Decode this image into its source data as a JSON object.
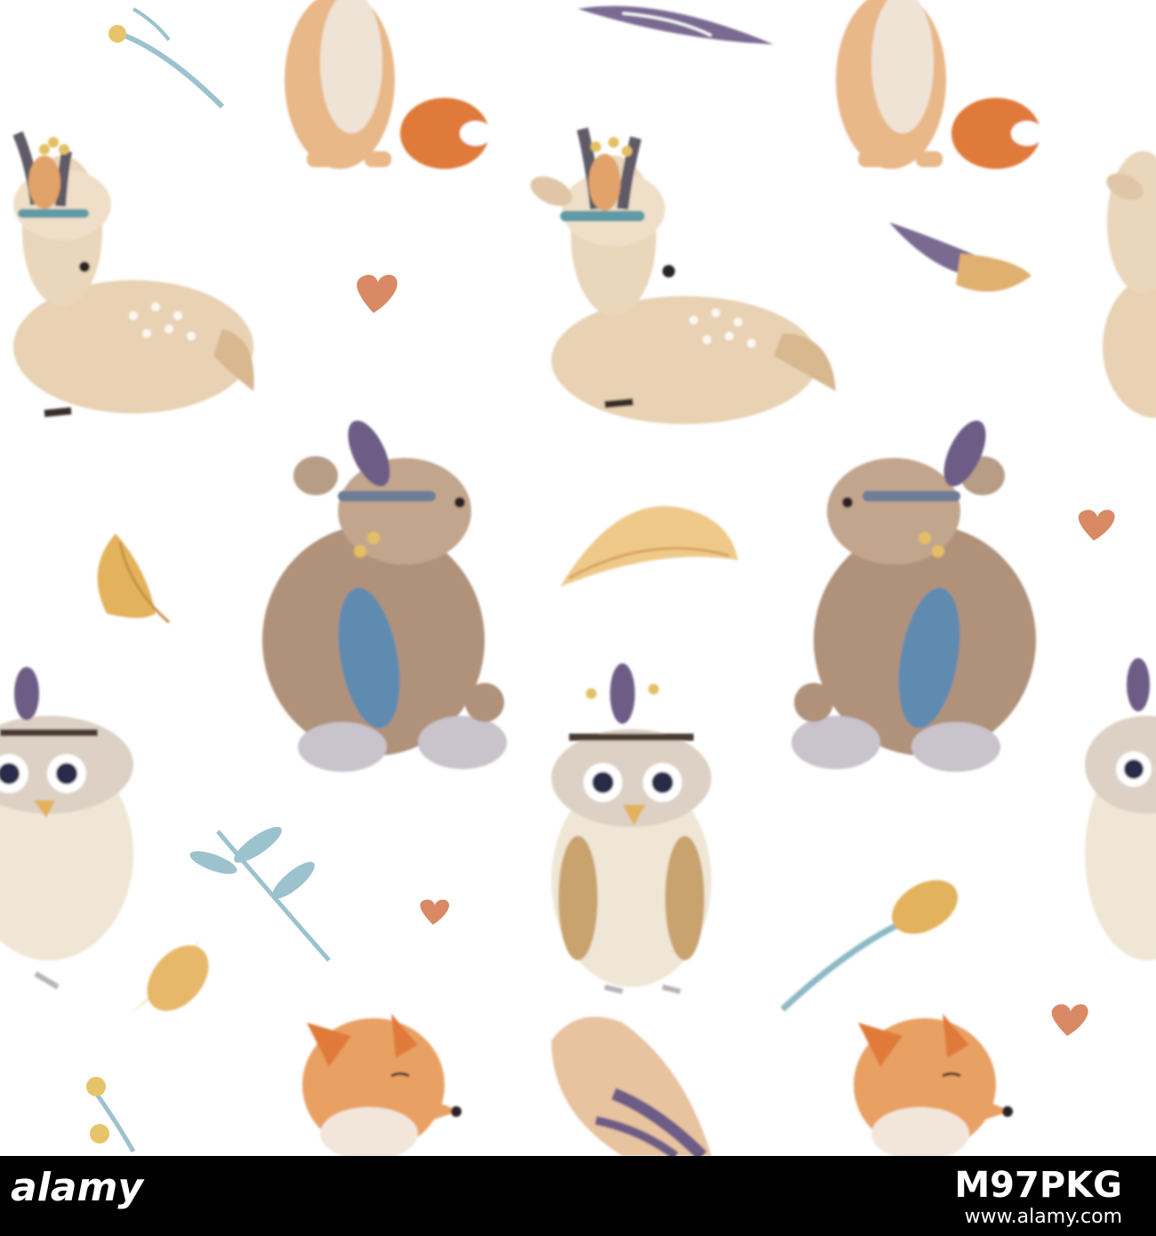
{
  "image": {
    "subject": "Seamless watercolor woodland animals pattern",
    "background_color": "#ffffff",
    "palette": {
      "fox_orange": "#e08a4a",
      "deer_tan": "#d9b98a",
      "bear_brown": "#9c7a5f",
      "owl_cream": "#efe6d6",
      "feather_blue": "#5f8bb0",
      "feather_purple": "#6d5d86",
      "leaf_gold": "#e3b25c",
      "heart_red": "#d97a5a",
      "sprig_teal": "#8cb8c4"
    }
  },
  "watermark": {
    "logo": "alamy",
    "image_id": "M97PKG",
    "url": "www.alamy.com"
  }
}
